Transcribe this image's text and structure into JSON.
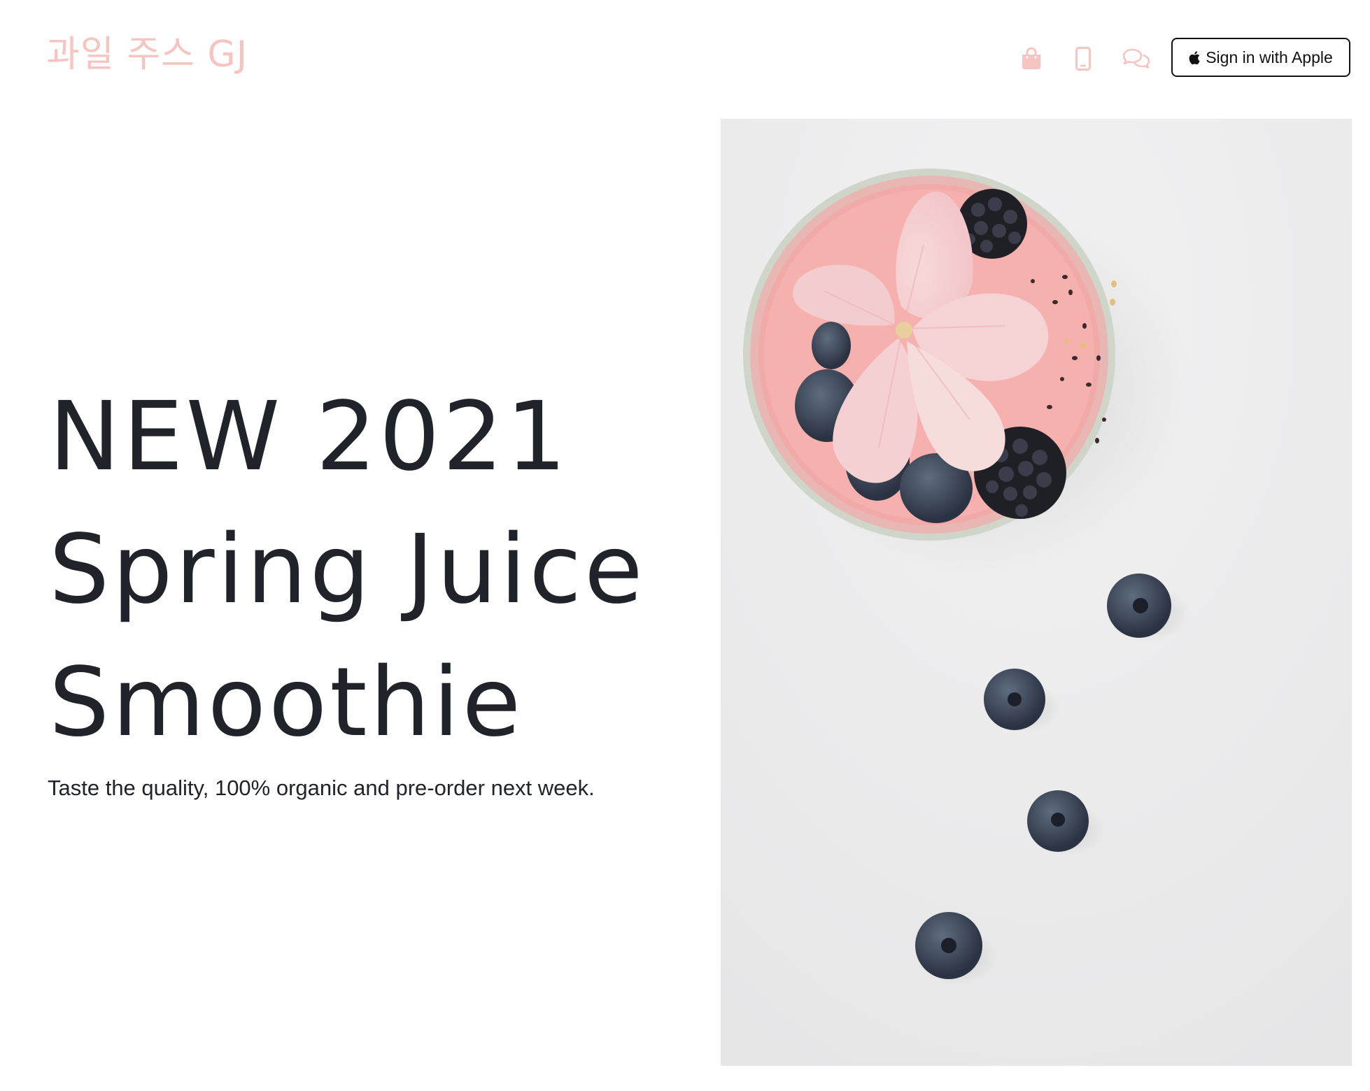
{
  "header": {
    "logo_text": "과일 주스 GJ",
    "icons": [
      "shopping-bag-icon",
      "phone-icon",
      "chat-icon"
    ],
    "sign_in_label": "Sign in with Apple"
  },
  "hero": {
    "title_lines": [
      "NEW 2021",
      "Spring Juice",
      "Smoothie"
    ],
    "subtitle": "Taste the quality, 100% organic and pre-order next week."
  },
  "colors": {
    "brand_pink": "#f6c5c1",
    "text_dark": "#20232a",
    "image_background": "#ebebeb"
  }
}
